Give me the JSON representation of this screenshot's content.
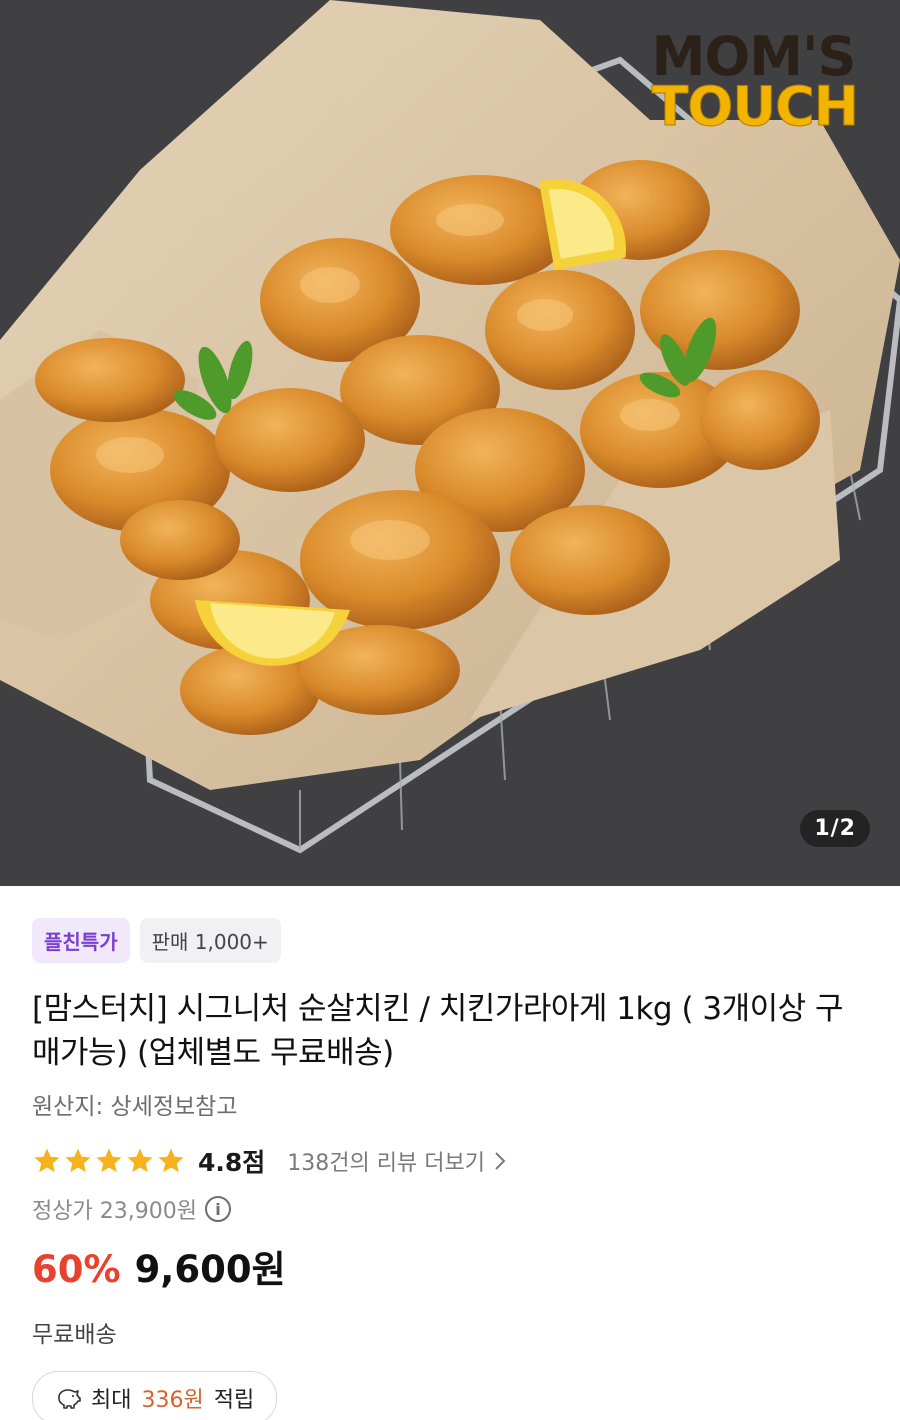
{
  "hero": {
    "logo_line1": "MOM'S",
    "logo_line2": "TOUCH",
    "image_counter": "1/2"
  },
  "product": {
    "badge_promo": "플친특가",
    "badge_sales": "판매 1,000+",
    "title": "[맘스터치] 시그니처 순살치킨 / 치킨가라아게 1kg ( 3개이상 구매가능) (업체별도 무료배송)",
    "origin": "원산지: 상세정보참고",
    "rating": {
      "stars": 5,
      "score_label": "4.8점",
      "reviews_label": "138건의 리뷰 더보기"
    },
    "original_price": "정상가 23,900원",
    "discount": "60%",
    "price": "9,600원",
    "shipping": "무료배송",
    "points": {
      "prefix": "최대",
      "amount": "336원",
      "suffix": "적립"
    }
  },
  "colors": {
    "discount": "#e8412e",
    "promo_badge_text": "#7a3fd0",
    "star": "#f5b21b",
    "points_amount": "#d4642a"
  },
  "icons": [
    "piggy-bank-icon",
    "info-icon",
    "chevron-right-icon",
    "star-icon"
  ]
}
